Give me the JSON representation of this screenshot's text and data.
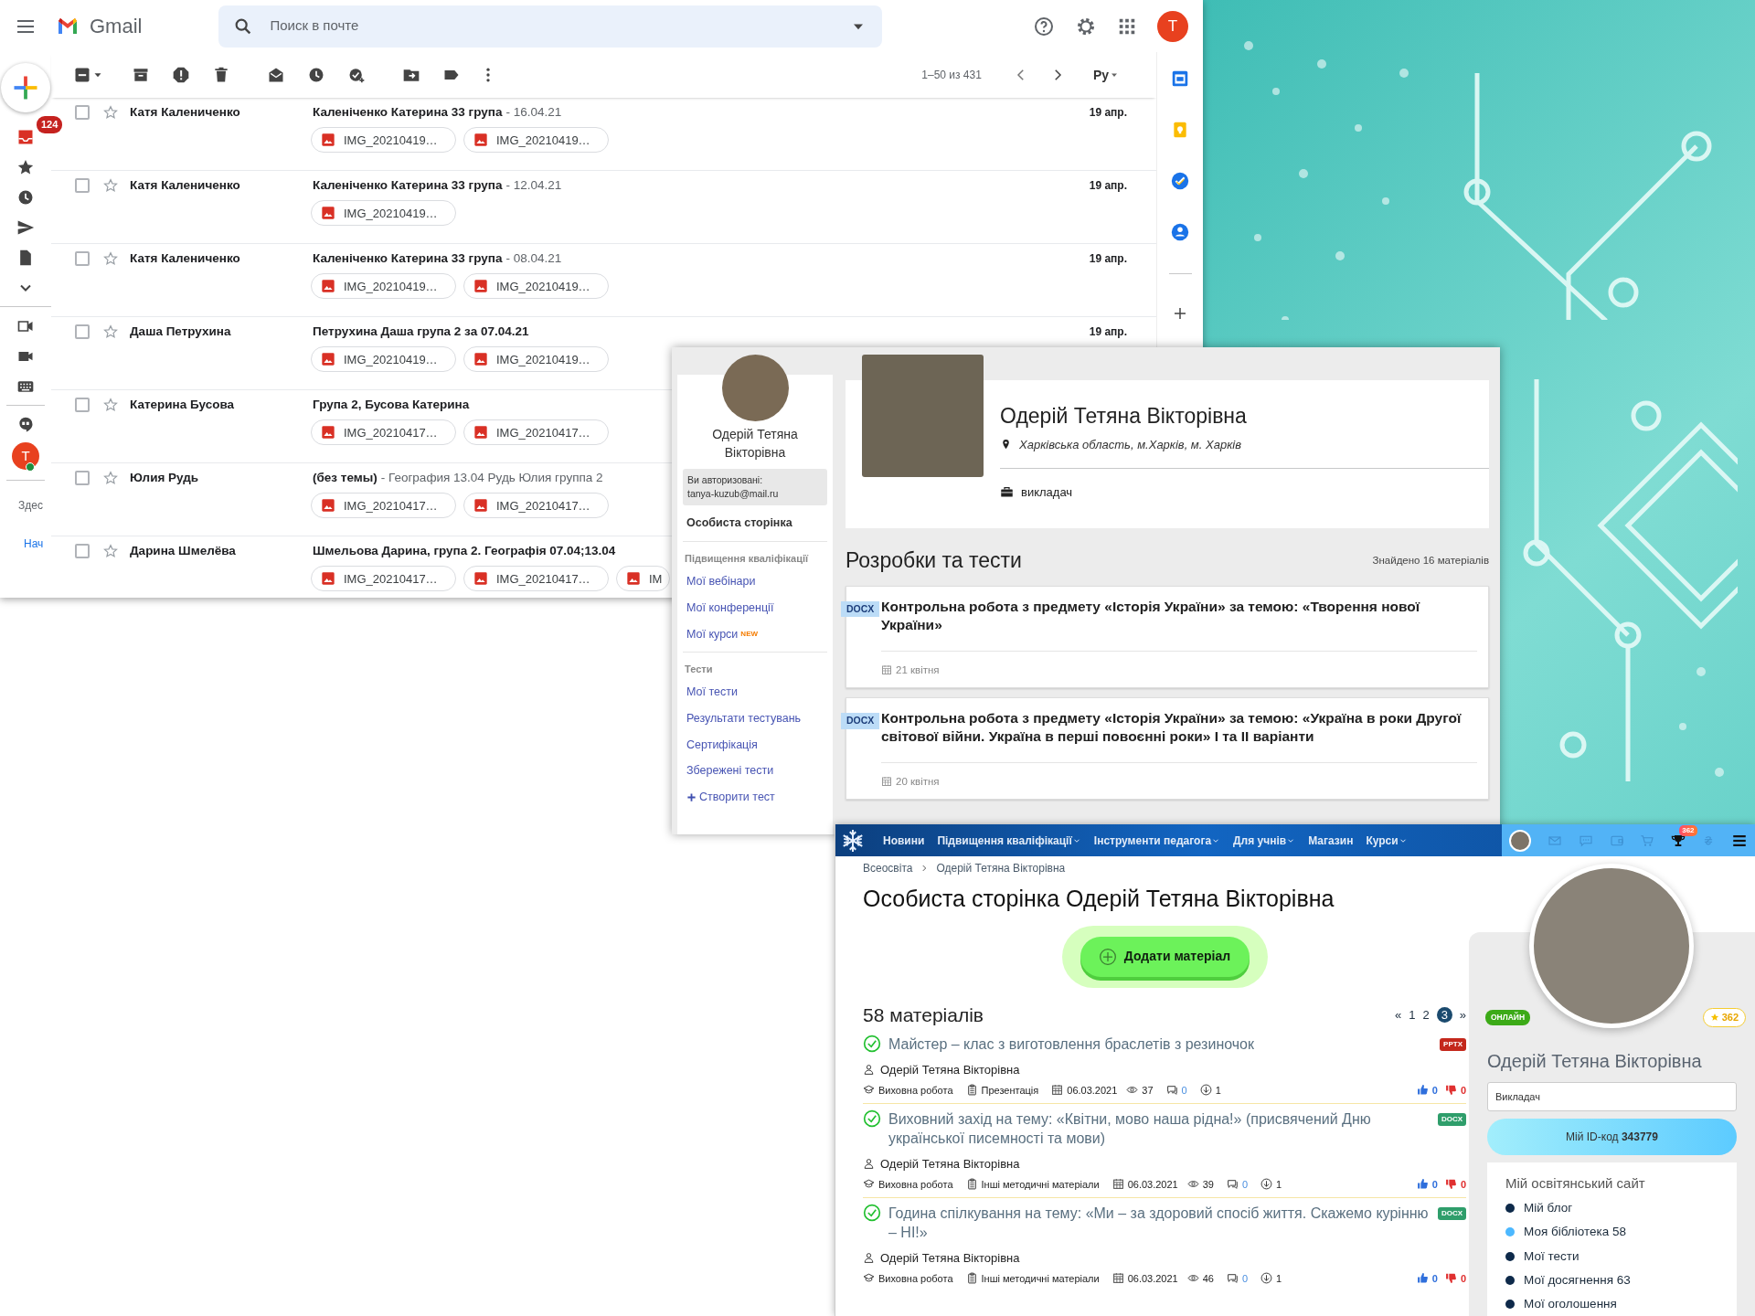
{
  "gmail": {
    "app_name": "Gmail",
    "search": {
      "placeholder": "Поиск в почте"
    },
    "account_letter": "T",
    "pagination": "1–50 из 431",
    "language": "Ру",
    "rail": {
      "inbox_badge": "124",
      "chat_letter": "T",
      "chat_online": true,
      "hint_text": "Здес",
      "start_link": "Нач"
    },
    "messages": [
      {
        "sender": "Катя Калениченко",
        "subject": "Каленіченко Катерина 33 група",
        "snippet": "- 16.04.21",
        "date": "19 апр.",
        "checked": false,
        "starred": false,
        "attachments": [
          "IMG_20210419…",
          "IMG_20210419…"
        ]
      },
      {
        "sender": "Катя Калениченко",
        "subject": "Каленіченко Катерина 33 група",
        "snippet": "- 12.04.21",
        "date": "19 апр.",
        "checked": false,
        "starred": false,
        "attachments": [
          "IMG_20210419…"
        ]
      },
      {
        "sender": "Катя Калениченко",
        "subject": "Каленіченко Катерина 33 група",
        "snippet": "- 08.04.21",
        "date": "19 апр.",
        "checked": false,
        "starred": false,
        "attachments": [
          "IMG_20210419…",
          "IMG_20210419…"
        ]
      },
      {
        "sender": "Даша Петрухина",
        "subject": "Петрухина Даша група 2 за 07.04.21",
        "date": "19 апр.",
        "checked": false,
        "starred": false,
        "attachments": [
          "IMG_20210419…",
          "IMG_20210419…"
        ]
      },
      {
        "sender": "Катерина Бусова",
        "subject": "Група 2, Бусова Катерина",
        "checked": false,
        "starred": false,
        "attachments": [
          "IMG_20210417…",
          "IMG_20210417…"
        ]
      },
      {
        "sender": "Юлия Рудь",
        "subject": "(без темы)",
        "snippet": "- География 13.04 Рудь Юлия группа 2",
        "checked": false,
        "starred": false,
        "attachments": [
          "IMG_20210417…",
          "IMG_20210417…"
        ]
      },
      {
        "sender": "Дарина Шмелёва",
        "subject": "Шмельова Дарина, група 2. Географія 07.04;13.04",
        "checked": false,
        "starred": false,
        "attachments": [
          "IMG_20210417…",
          "IMG_20210417…",
          "IM"
        ]
      }
    ]
  },
  "profile_window": {
    "sidebar": {
      "name": "Одерій Тетяна Вікторівна",
      "auth_label": "Ви авторизовані:",
      "auth_email": "tanya-kuzub@mail.ru",
      "personal_page": "Особиста сторінка",
      "groups": [
        {
          "heading": "Підвищення кваліфікації",
          "links": [
            {
              "label": "Мої вебінари"
            },
            {
              "label": "Мої конференції"
            },
            {
              "label": "Мої курси",
              "badge": "NEW"
            }
          ]
        },
        {
          "heading": "Тести",
          "links": [
            {
              "label": "Мої тести"
            },
            {
              "label": "Результати тестувань"
            },
            {
              "label": "Сертифікація"
            },
            {
              "label": "Збережені тести"
            },
            {
              "label": "Створити тест",
              "kind": "create"
            }
          ]
        }
      ]
    },
    "header": {
      "name": "Одерій Тетяна Вікторівна",
      "location": "Харківська область, м.Харків, м. Харків",
      "role": "викладач"
    },
    "section_title": "Розробки та тести",
    "found": "Знайдено 16 матеріалів",
    "materials": [
      {
        "format": "DOCX",
        "title": "Контрольна робота з предмету «Історія України» за темою: «Творення нової України»",
        "date": "21 квітня"
      },
      {
        "format": "DOCX",
        "title": "Контрольна робота з предмету «Історія України» за темою: «Україна в роки Другої світової війни. Україна в перші повоєнні роки» І та ІІ варіанти",
        "date": "20 квітня"
      }
    ]
  },
  "site_window": {
    "nav": [
      {
        "label": "Новини",
        "dropdown": false
      },
      {
        "label": "Підвищення кваліфікації",
        "dropdown": true
      },
      {
        "label": "Інструменти педагога",
        "dropdown": true
      },
      {
        "label": "Для учнів",
        "dropdown": true
      },
      {
        "label": "Магазин",
        "dropdown": false
      },
      {
        "label": "Курси",
        "dropdown": true
      }
    ],
    "awards_badge": "362",
    "breadcrumb": [
      "Всеосвіта",
      "Одерій Тетяна Вікторівна"
    ],
    "title": "Особиста сторінка Одерій Тетяна Вікторівна",
    "add_button": "Додати матеріал",
    "materials_count": "58 матеріалів",
    "pages": [
      {
        "label": "«",
        "selected": false
      },
      {
        "label": "1",
        "selected": false
      },
      {
        "label": "2",
        "selected": false
      },
      {
        "label": "3",
        "selected": true
      },
      {
        "label": "»",
        "selected": false
      }
    ],
    "items": [
      {
        "verified": true,
        "title": "Майстер – клас з виготовлення браслетів з резиночок",
        "format": "PPTX",
        "color": "#c4281c",
        "author": "Одерій Тетяна Вікторівна",
        "category": "Виховна робота",
        "type": "Презентація",
        "date": "06.03.2021",
        "views": "37",
        "comments": "0",
        "downloads": "1",
        "likes": "0",
        "dislikes": "0"
      },
      {
        "verified": true,
        "title": "Виховний захід на тему: «Квітни, мово наша рідна!» (присвячений Дню української писемності та мови)",
        "format": "DOCX",
        "color": "#2f9e6b",
        "author": "Одерій Тетяна Вікторівна",
        "category": "Виховна робота",
        "type": "Інші методичні матеріали",
        "date": "06.03.2021",
        "views": "39",
        "comments": "0",
        "downloads": "1",
        "likes": "0",
        "dislikes": "0"
      },
      {
        "verified": true,
        "title": "Година спілкування на тему: «Ми – за здоровий спосіб життя. Скажемо курінню – НІ!»",
        "format": "DOCX",
        "color": "#2f9e6b",
        "author": "Одерій Тетяна Вікторівна",
        "category": "Виховна робота",
        "type": "Інші методичні матеріали",
        "date": "06.03.2021",
        "views": "46",
        "comments": "0",
        "downloads": "1",
        "likes": "0",
        "dislikes": "0"
      }
    ],
    "profile": {
      "status": "ОНЛАЙН",
      "rating": "362",
      "name": "Одерій Тетяна Вікторівна",
      "role_value": "Викладач",
      "id_code": "Мій ID-код **343779**",
      "site_heading": "Мій освітянський сайт",
      "links": [
        {
          "label": "Мій блог",
          "selected": false
        },
        {
          "label": "Моя бібліотека 58",
          "selected": true
        },
        {
          "label": "Мої тести",
          "selected": false
        },
        {
          "label": "Мої досягнення 63",
          "selected": false
        },
        {
          "label": "Мої оголошення",
          "selected": false
        }
      ]
    }
  }
}
